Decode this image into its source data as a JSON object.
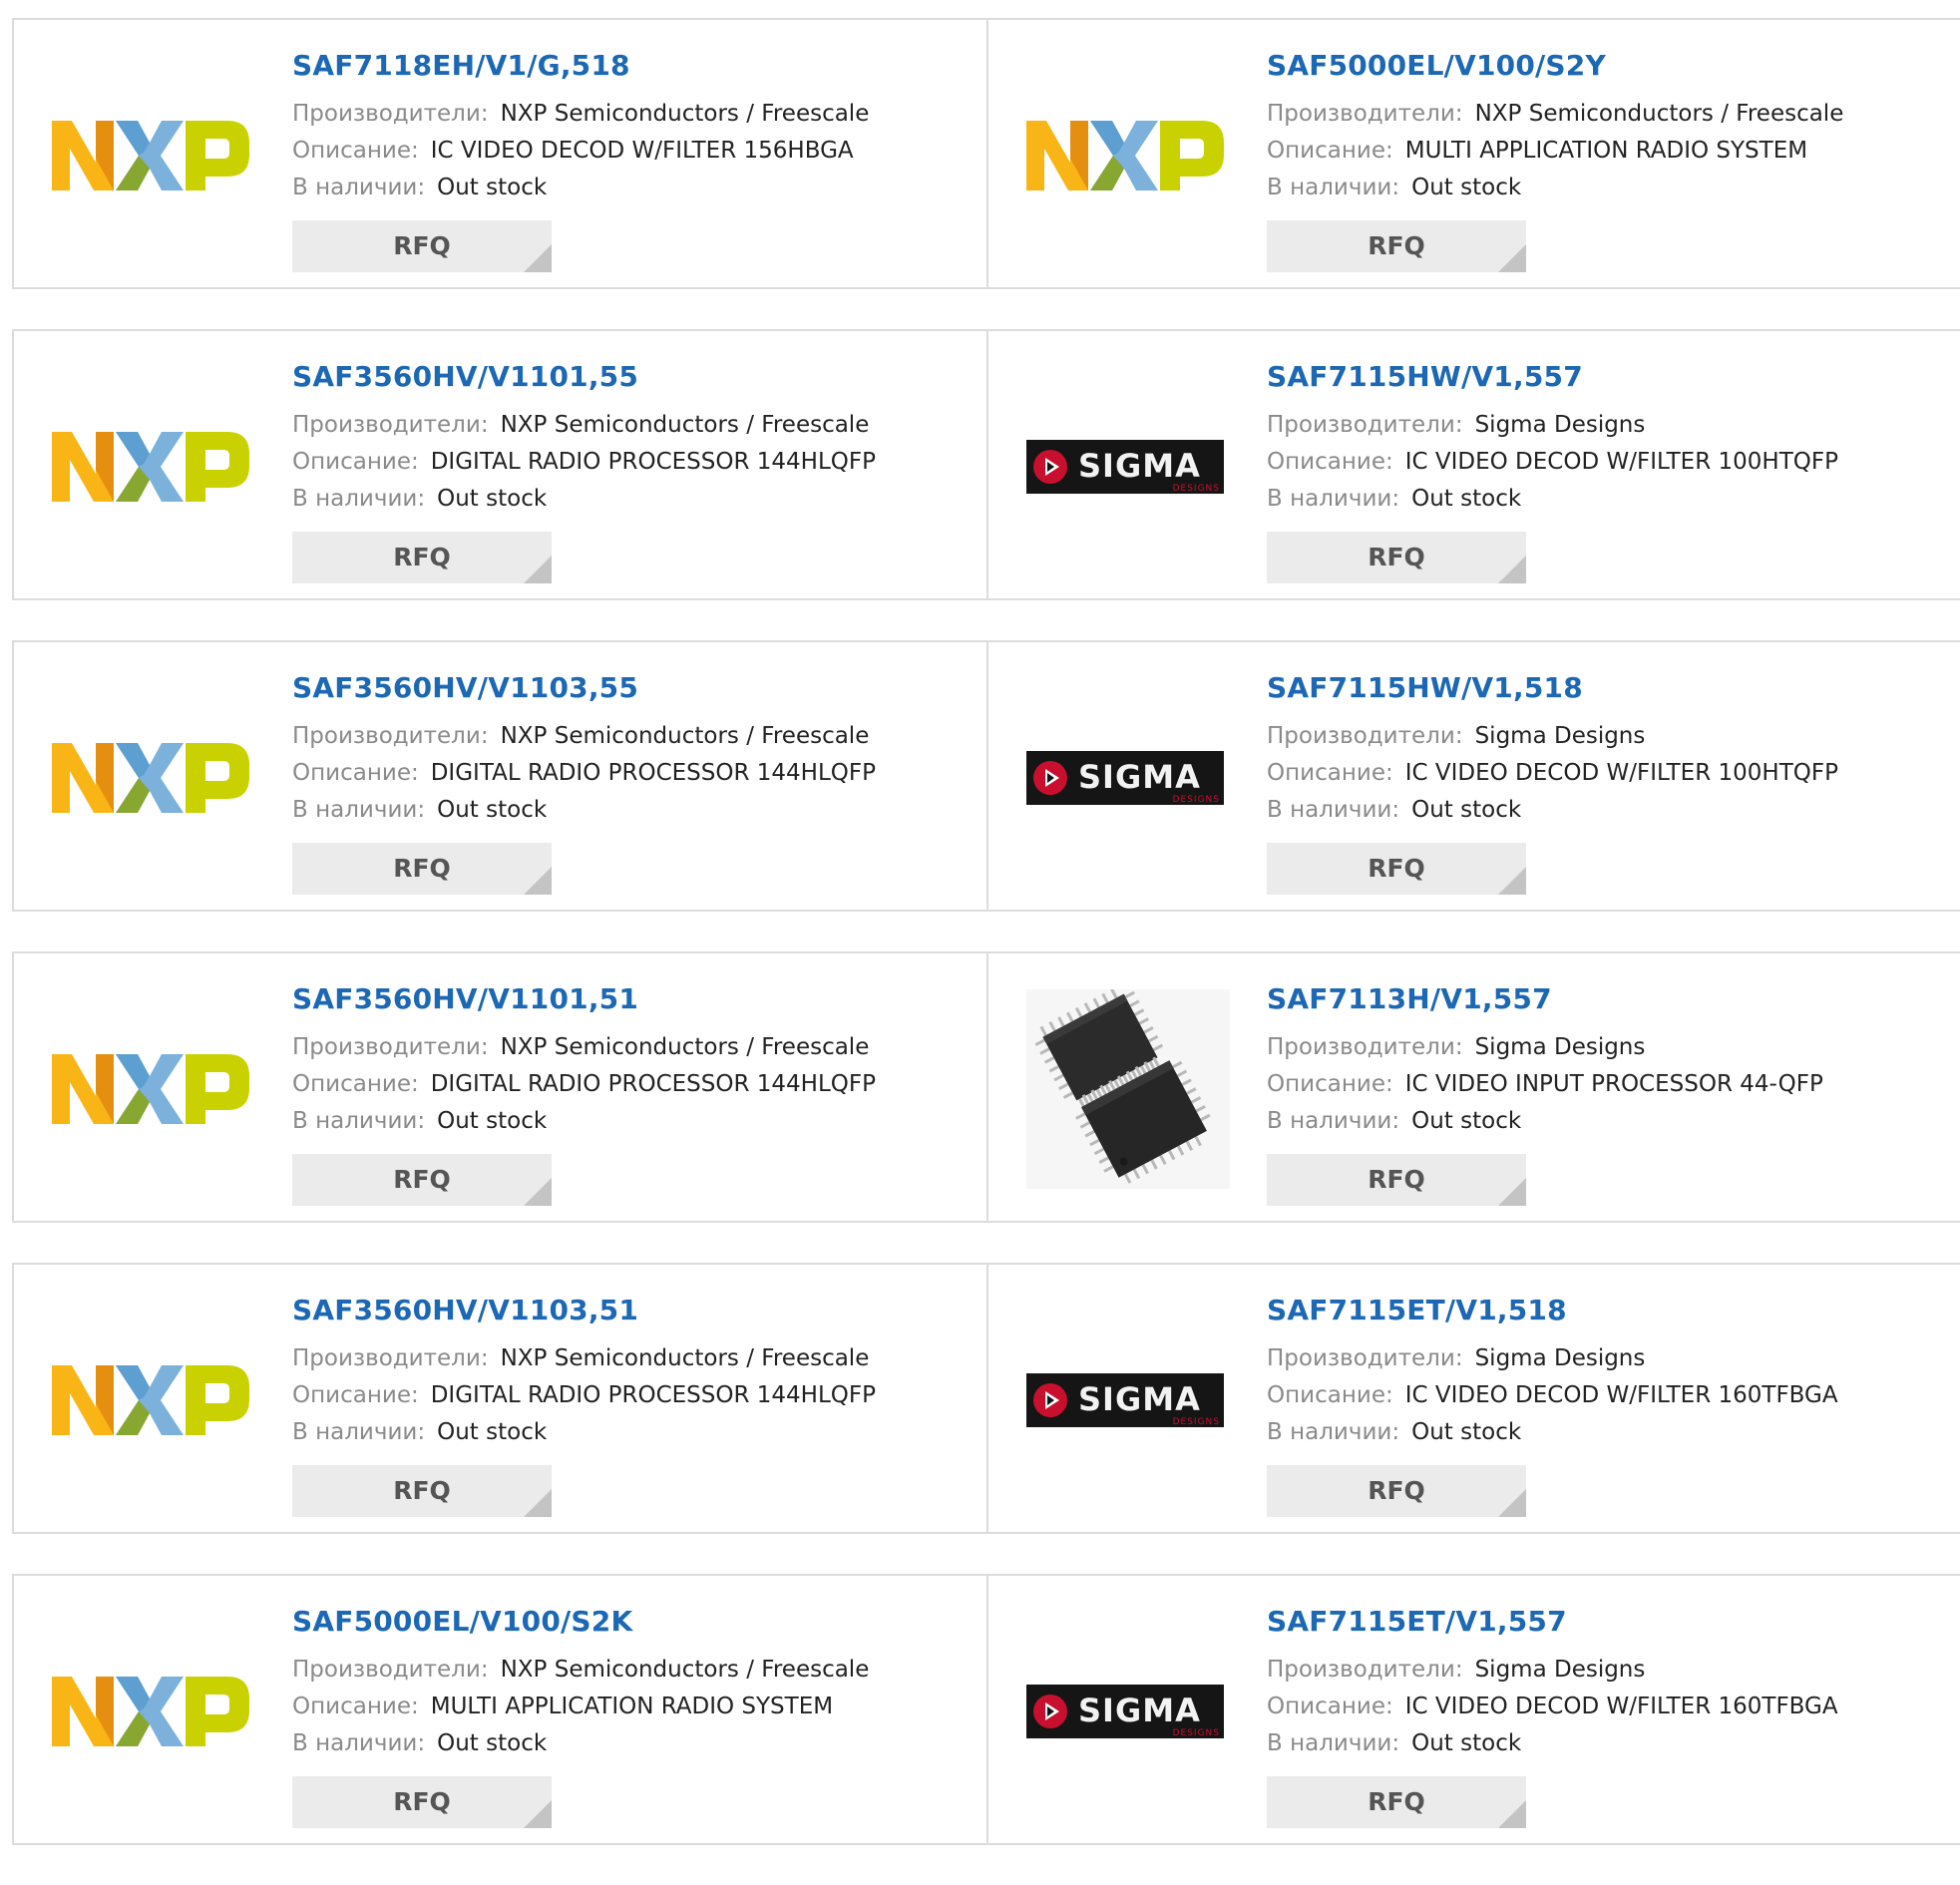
{
  "labels": {
    "manufacturer": "Производители:",
    "description": "Описание:",
    "availability": "В наличии:",
    "rfq": "RFQ"
  },
  "colors": {
    "part_link": "#1c68b4",
    "nxp_orange": "#f9b516",
    "nxp_blue": "#7bb1db",
    "nxp_green": "#c9d200",
    "sigma_red": "#c8102e"
  },
  "products": [
    [
      {
        "part": "SAF7118EH/V1/G,518",
        "manufacturer": "NXP Semiconductors / Freescale",
        "description": "IC VIDEO DECOD W/FILTER 156HBGA",
        "availability": "Out stock",
        "logo": "nxp-logo"
      },
      {
        "part": "SAF5000EL/V100/S2Y",
        "manufacturer": "NXP Semiconductors / Freescale",
        "description": "MULTI APPLICATION RADIO SYSTEM",
        "availability": "Out stock",
        "logo": "nxp-logo"
      }
    ],
    [
      {
        "part": "SAF3560HV/V1101,55",
        "manufacturer": "NXP Semiconductors / Freescale",
        "description": "DIGITAL RADIO PROCESSOR 144HLQFP",
        "availability": "Out stock",
        "logo": "nxp-logo"
      },
      {
        "part": "SAF7115HW/V1,557",
        "manufacturer": "Sigma Designs",
        "description": "IC VIDEO DECOD W/FILTER 100HTQFP",
        "availability": "Out stock",
        "logo": "sigma-logo",
        "logo_text": "SIGMA",
        "logo_subtext": "DESIGNS"
      }
    ],
    [
      {
        "part": "SAF3560HV/V1103,55",
        "manufacturer": "NXP Semiconductors / Freescale",
        "description": "DIGITAL RADIO PROCESSOR 144HLQFP",
        "availability": "Out stock",
        "logo": "nxp-logo"
      },
      {
        "part": "SAF7115HW/V1,518",
        "manufacturer": "Sigma Designs",
        "description": "IC VIDEO DECOD W/FILTER 100HTQFP",
        "availability": "Out stock",
        "logo": "sigma-logo",
        "logo_text": "SIGMA",
        "logo_subtext": "DESIGNS"
      }
    ],
    [
      {
        "part": "SAF3560HV/V1101,51",
        "manufacturer": "NXP Semiconductors / Freescale",
        "description": "DIGITAL RADIO PROCESSOR 144HLQFP",
        "availability": "Out stock",
        "logo": "nxp-logo"
      },
      {
        "part": "SAF7113H/V1,557",
        "manufacturer": "Sigma Designs",
        "description": "IC VIDEO INPUT PROCESSOR 44-QFP",
        "availability": "Out stock",
        "logo": "chip-image"
      }
    ],
    [
      {
        "part": "SAF3560HV/V1103,51",
        "manufacturer": "NXP Semiconductors / Freescale",
        "description": "DIGITAL RADIO PROCESSOR 144HLQFP",
        "availability": "Out stock",
        "logo": "nxp-logo"
      },
      {
        "part": "SAF7115ET/V1,518",
        "manufacturer": "Sigma Designs",
        "description": "IC VIDEO DECOD W/FILTER 160TFBGA",
        "availability": "Out stock",
        "logo": "sigma-logo",
        "logo_text": "SIGMA",
        "logo_subtext": "DESIGNS"
      }
    ],
    [
      {
        "part": "SAF5000EL/V100/S2K",
        "manufacturer": "NXP Semiconductors / Freescale",
        "description": "MULTI APPLICATION RADIO SYSTEM",
        "availability": "Out stock",
        "logo": "nxp-logo"
      },
      {
        "part": "SAF7115ET/V1,557",
        "manufacturer": "Sigma Designs",
        "description": "IC VIDEO DECOD W/FILTER 160TFBGA",
        "availability": "Out stock",
        "logo": "sigma-logo",
        "logo_text": "SIGMA",
        "logo_subtext": "DESIGNS"
      }
    ]
  ]
}
